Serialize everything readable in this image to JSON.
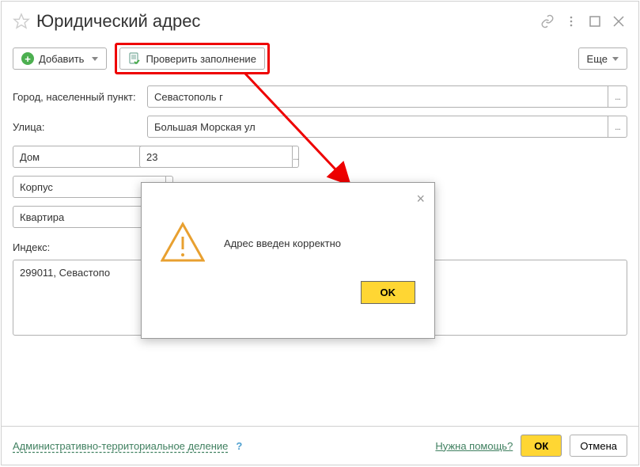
{
  "title": "Юридический адрес",
  "toolbar": {
    "add_label": "Добавить",
    "check_label": "Проверить заполнение",
    "more_label": "Еще"
  },
  "form": {
    "city_label": "Город, населенный пункт:",
    "city_value": "Севастополь г",
    "street_label": "Улица:",
    "street_value": "Большая Морская ул",
    "house_type": "Дом",
    "house_value": "23",
    "building_type": "Корпус",
    "apartment_type": "Квартира",
    "index_label": "Индекс:",
    "full_address": "299011, Севастопо"
  },
  "footer": {
    "admin_link": "Административно-территориальное деление",
    "help_q": "?",
    "help_link": "Нужна помощь?",
    "ok_label": "ОК",
    "cancel_label": "Отмена"
  },
  "dialog": {
    "message": "Адрес введен корректно",
    "ok_label": "OK"
  }
}
